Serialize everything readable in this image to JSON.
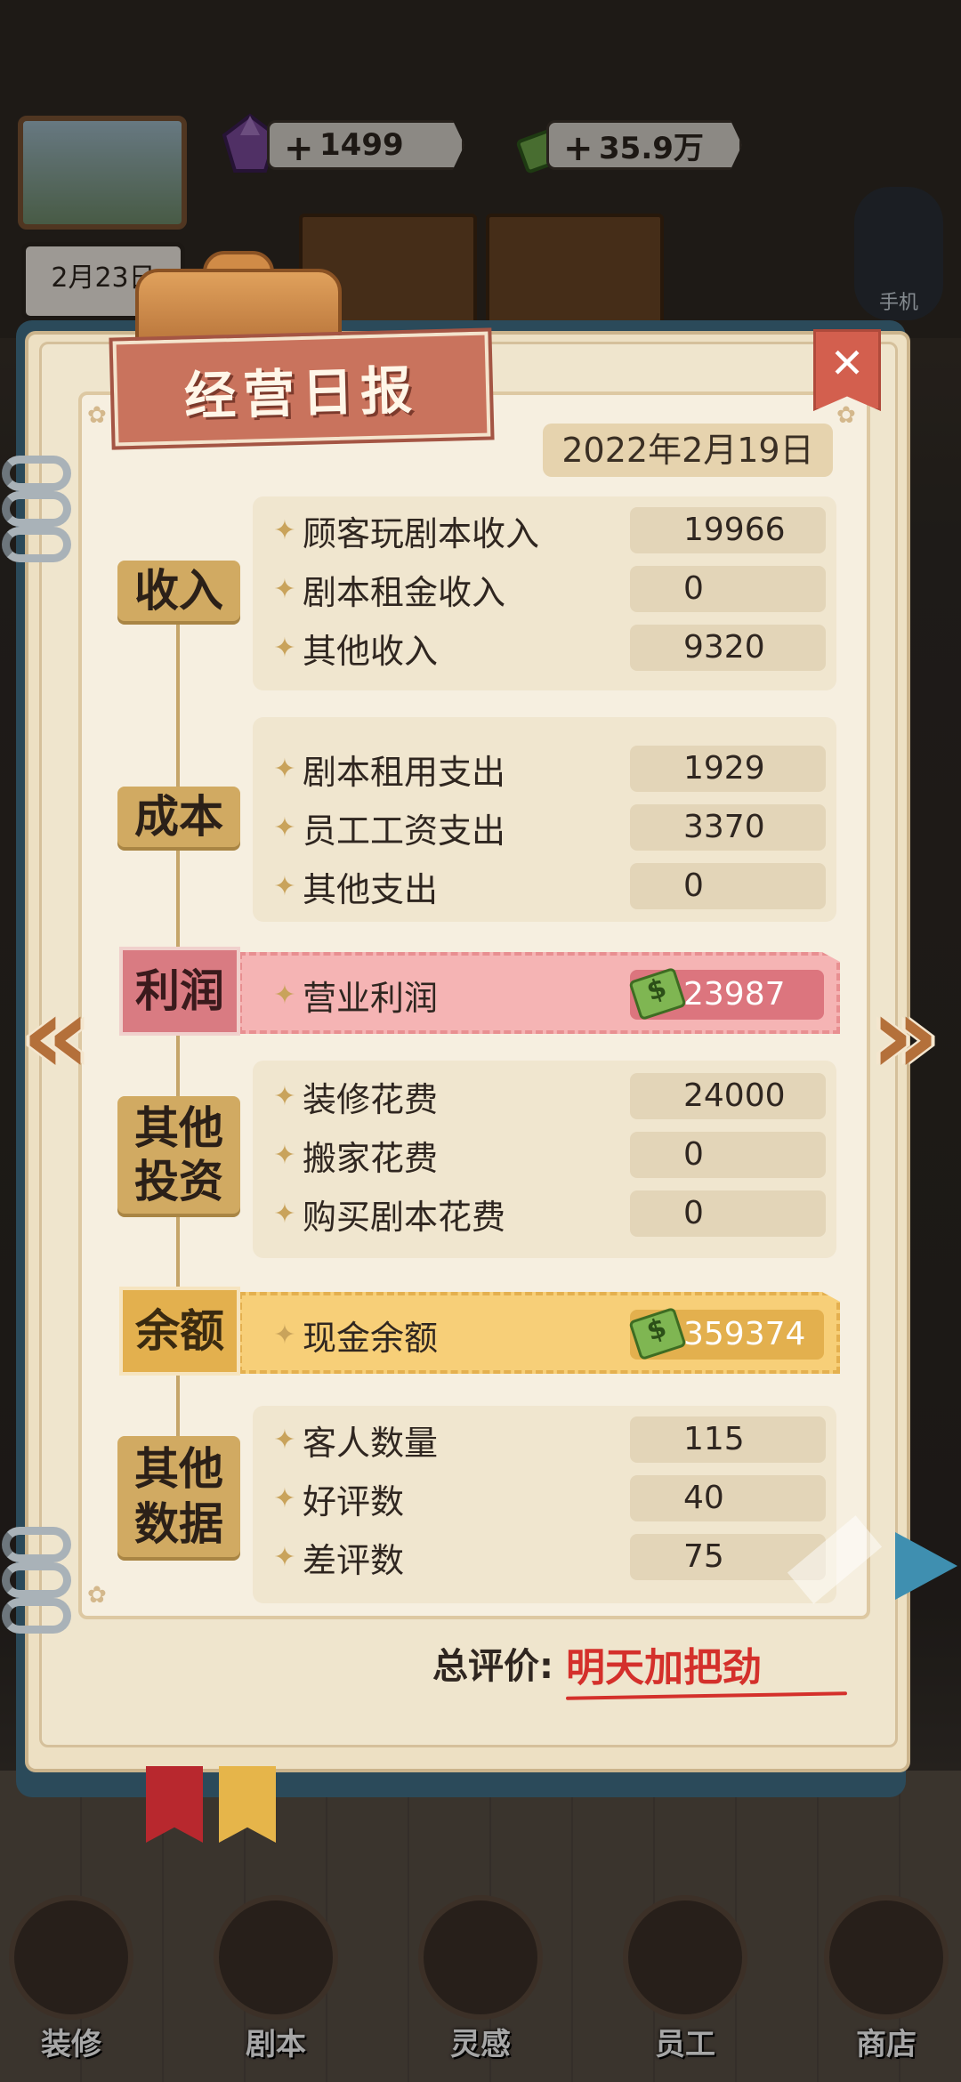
{
  "hud": {
    "gems": "1499",
    "cash": "35.9万",
    "plus_symbol": "+",
    "date": "2月23日",
    "phone_label": "手机"
  },
  "report": {
    "title": "经营日报",
    "close_symbol": "✕",
    "date": "2022年2月19日",
    "income": {
      "category": "收入",
      "rows": [
        {
          "label": "顾客玩剧本收入",
          "value": "19966"
        },
        {
          "label": "剧本租金收入",
          "value": "0"
        },
        {
          "label": "其他收入",
          "value": "9320"
        }
      ]
    },
    "cost": {
      "category": "成本",
      "rows": [
        {
          "label": "剧本租用支出",
          "value": "1929"
        },
        {
          "label": "员工工资支出",
          "value": "3370"
        },
        {
          "label": "其他支出",
          "value": "0"
        }
      ]
    },
    "profit": {
      "category": "利润",
      "label": "营业利润",
      "value": "23987"
    },
    "investment": {
      "category_line1": "其他",
      "category_line2": "投资",
      "rows": [
        {
          "label": "装修花费",
          "value": "24000"
        },
        {
          "label": "搬家花费",
          "value": "0"
        },
        {
          "label": "购买剧本花费",
          "value": "0"
        }
      ]
    },
    "balance": {
      "category": "余额",
      "label": "现金余额",
      "value": "359374"
    },
    "other_data": {
      "category_line1": "其他",
      "category_line2": "数据",
      "rows": [
        {
          "label": "客人数量",
          "value": "115"
        },
        {
          "label": "好评数",
          "value": "40"
        },
        {
          "label": "差评数",
          "value": "75"
        }
      ]
    },
    "summary_label": "总评价:",
    "summary_value": "明天加把劲"
  },
  "nav": {
    "items": [
      {
        "label": "装修",
        "icon": "house-icon"
      },
      {
        "label": "剧本",
        "icon": "book-icon"
      },
      {
        "label": "灵感",
        "icon": "lightbulb-icon"
      },
      {
        "label": "员工",
        "icon": "badge-icon"
      },
      {
        "label": "商店",
        "icon": "shop-icon"
      }
    ]
  },
  "colors": {
    "profit_bg": "#f5b4b4",
    "balance_bg": "#f7cf78",
    "summary_red": "#d4302b",
    "title_banner": "#c9735d"
  }
}
